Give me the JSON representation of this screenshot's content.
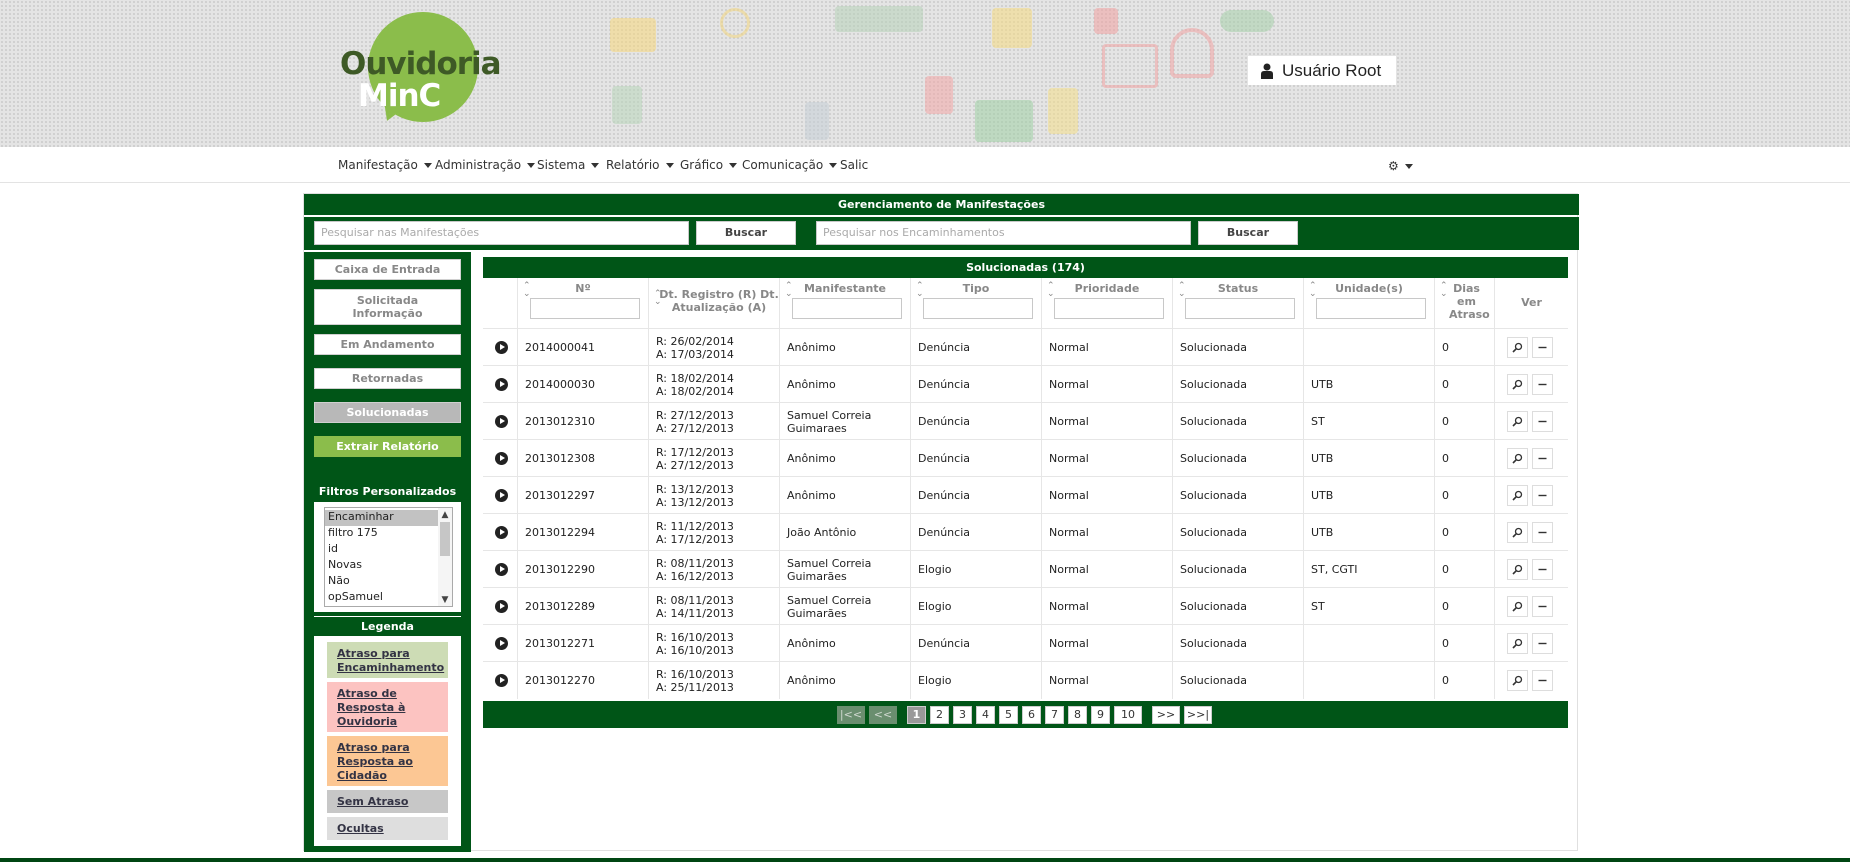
{
  "header": {
    "logo_line1": "Ouvidoria",
    "logo_line2": "MinC",
    "user": "Usuário Root"
  },
  "nav": {
    "items": [
      "Manifestação",
      "Administração",
      "Sistema",
      "Relatório",
      "Gráfico",
      "Comunicação",
      "Salic"
    ]
  },
  "panel": {
    "title": "Gerenciamento de Manifestações",
    "search_manifest_placeholder": "Pesquisar nas Manifestações",
    "search_manifest_button": "Buscar",
    "search_encaminhamento_placeholder": "Pesquisar nos Encaminhamentos",
    "search_encaminhamento_button": "Buscar"
  },
  "sidebar": {
    "caixa": "Caixa de Entrada",
    "solicitada": "Solicitada Informação",
    "andamento": "Em Andamento",
    "retornadas": "Retornadas",
    "solucionadas": "Solucionadas",
    "extrair": "Extrair Relatório",
    "filters_title": "Filtros Personalizados",
    "filters": [
      "Encaminhar",
      "filtro 175",
      "id",
      "Novas",
      "Não",
      "opSamuel"
    ],
    "legend_title": "Legenda",
    "legend": [
      {
        "label": "Atraso para Encaminhamento",
        "color": "#cddcb5"
      },
      {
        "label": "Atraso de Resposta à Ouvidoria",
        "color": "#fcc3c1"
      },
      {
        "label": "Atraso para Resposta ao Cidadão",
        "color": "#fcc794"
      },
      {
        "label": "Sem Atraso",
        "color": "#c7c7c7"
      },
      {
        "label": "Ocultas",
        "color": "#dedede"
      }
    ]
  },
  "table": {
    "title": "Solucionadas (174)",
    "columns": {
      "numero": "Nº",
      "datas": "Dt. Registro (R) Dt. Atualização (A)",
      "manifestante": "Manifestante",
      "tipo": "Tipo",
      "prioridade": "Prioridade",
      "status": "Status",
      "unidades": "Unidade(s)",
      "atraso": "Dias em Atraso",
      "ver": "Ver"
    },
    "rows": [
      {
        "numero": "2014000041",
        "registro": "R: 26/02/2014",
        "atualizacao": "A: 17/03/2014",
        "manifestante": "Anônimo",
        "tipo": "Denúncia",
        "prioridade": "Normal",
        "status": "Solucionada",
        "unidades": "",
        "atraso": "0"
      },
      {
        "numero": "2014000030",
        "registro": "R: 18/02/2014",
        "atualizacao": "A: 18/02/2014",
        "manifestante": "Anônimo",
        "tipo": "Denúncia",
        "prioridade": "Normal",
        "status": "Solucionada",
        "unidades": "UTB",
        "atraso": "0"
      },
      {
        "numero": "2013012310",
        "registro": "R: 27/12/2013",
        "atualizacao": "A: 27/12/2013",
        "manifestante": "Samuel Correia Guimaraes",
        "tipo": "Denúncia",
        "prioridade": "Normal",
        "status": "Solucionada",
        "unidades": "ST",
        "atraso": "0"
      },
      {
        "numero": "2013012308",
        "registro": "R: 17/12/2013",
        "atualizacao": "A: 27/12/2013",
        "manifestante": "Anônimo",
        "tipo": "Denúncia",
        "prioridade": "Normal",
        "status": "Solucionada",
        "unidades": "UTB",
        "atraso": "0"
      },
      {
        "numero": "2013012297",
        "registro": "R: 13/12/2013",
        "atualizacao": "A: 13/12/2013",
        "manifestante": "Anônimo",
        "tipo": "Denúncia",
        "prioridade": "Normal",
        "status": "Solucionada",
        "unidades": "UTB",
        "atraso": "0"
      },
      {
        "numero": "2013012294",
        "registro": "R: 11/12/2013",
        "atualizacao": "A: 17/12/2013",
        "manifestante": "João Antônio",
        "tipo": "Denúncia",
        "prioridade": "Normal",
        "status": "Solucionada",
        "unidades": "UTB",
        "atraso": "0"
      },
      {
        "numero": "2013012290",
        "registro": "R: 08/11/2013",
        "atualizacao": "A: 16/12/2013",
        "manifestante": "Samuel Correia Guimarães",
        "tipo": "Elogio",
        "prioridade": "Normal",
        "status": "Solucionada",
        "unidades": "ST, CGTI",
        "atraso": "0"
      },
      {
        "numero": "2013012289",
        "registro": "R: 08/11/2013",
        "atualizacao": "A: 14/11/2013",
        "manifestante": "Samuel Correia Guimarães",
        "tipo": "Elogio",
        "prioridade": "Normal",
        "status": "Solucionada",
        "unidades": "ST",
        "atraso": "0"
      },
      {
        "numero": "2013012271",
        "registro": "R: 16/10/2013",
        "atualizacao": "A: 16/10/2013",
        "manifestante": "Anônimo",
        "tipo": "Denúncia",
        "prioridade": "Normal",
        "status": "Solucionada",
        "unidades": "",
        "atraso": "0"
      },
      {
        "numero": "2013012270",
        "registro": "R: 16/10/2013",
        "atualizacao": "A: 25/11/2013",
        "manifestante": "Anônimo",
        "tipo": "Elogio",
        "prioridade": "Normal",
        "status": "Solucionada",
        "unidades": "",
        "atraso": "0"
      }
    ]
  },
  "pager": {
    "first": "|<<",
    "prev": "<<",
    "pages": [
      "1",
      "2",
      "3",
      "4",
      "5",
      "6",
      "7",
      "8",
      "9",
      "10"
    ],
    "current": "1",
    "next": ">>",
    "last": ">>|"
  }
}
